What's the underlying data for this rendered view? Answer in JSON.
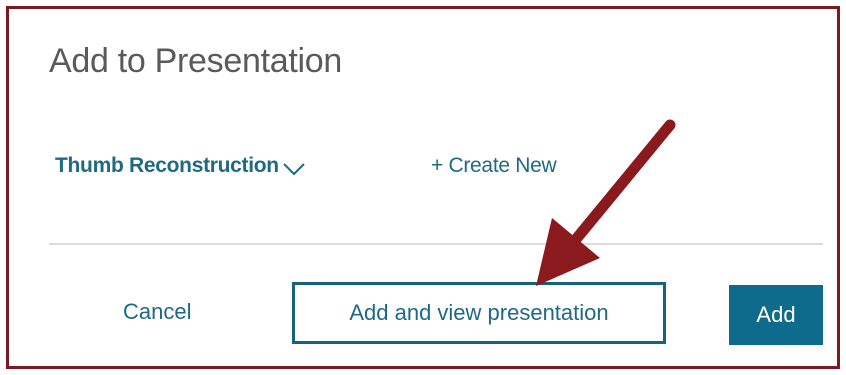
{
  "dialog": {
    "title": "Add to Presentation",
    "presentation_select": {
      "selected": "Thumb Reconstruction",
      "icon": "chevron-down-icon"
    },
    "create_new_label": "+ Create New"
  },
  "footer": {
    "cancel_label": "Cancel",
    "add_view_label": "Add and view presentation",
    "add_label": "Add"
  },
  "annotation": {
    "arrow_icon": "arrow-annotation-icon",
    "colors": {
      "frame": "#7a1b24",
      "arrow": "#8b1a1f"
    }
  },
  "colors": {
    "link": "#1e6a85",
    "primary_button": "#0f6b8b",
    "title": "#5a5a5a"
  }
}
